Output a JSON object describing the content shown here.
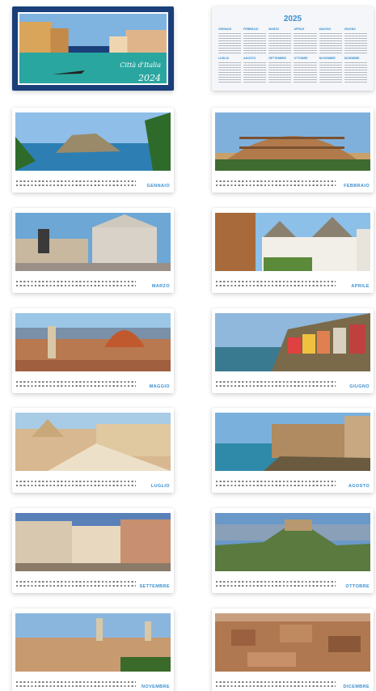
{
  "cover": {
    "title": "Città d'Italia",
    "year": "2024"
  },
  "year_overview": {
    "year": "2025",
    "months": [
      "Gennaio",
      "Febbraio",
      "Marzo",
      "Aprile",
      "Maggio",
      "Giugno",
      "Luglio",
      "Agosto",
      "Settembre",
      "Ottobre",
      "Novembre",
      "Dicembre"
    ]
  },
  "months": [
    {
      "name": "GENNAIO"
    },
    {
      "name": "FEBBRAIO"
    },
    {
      "name": "MARZO"
    },
    {
      "name": "APRILE"
    },
    {
      "name": "MAGGIO"
    },
    {
      "name": "GIUGNO"
    },
    {
      "name": "LUGLIO"
    },
    {
      "name": "AGOSTO"
    },
    {
      "name": "SETTEMBRE"
    },
    {
      "name": "OTTOBRE"
    },
    {
      "name": "NOVEMBRE"
    },
    {
      "name": "DICEMBRE"
    }
  ],
  "colors": {
    "accent": "#3a8fd0",
    "cover_bg": "#1a3f7a"
  }
}
